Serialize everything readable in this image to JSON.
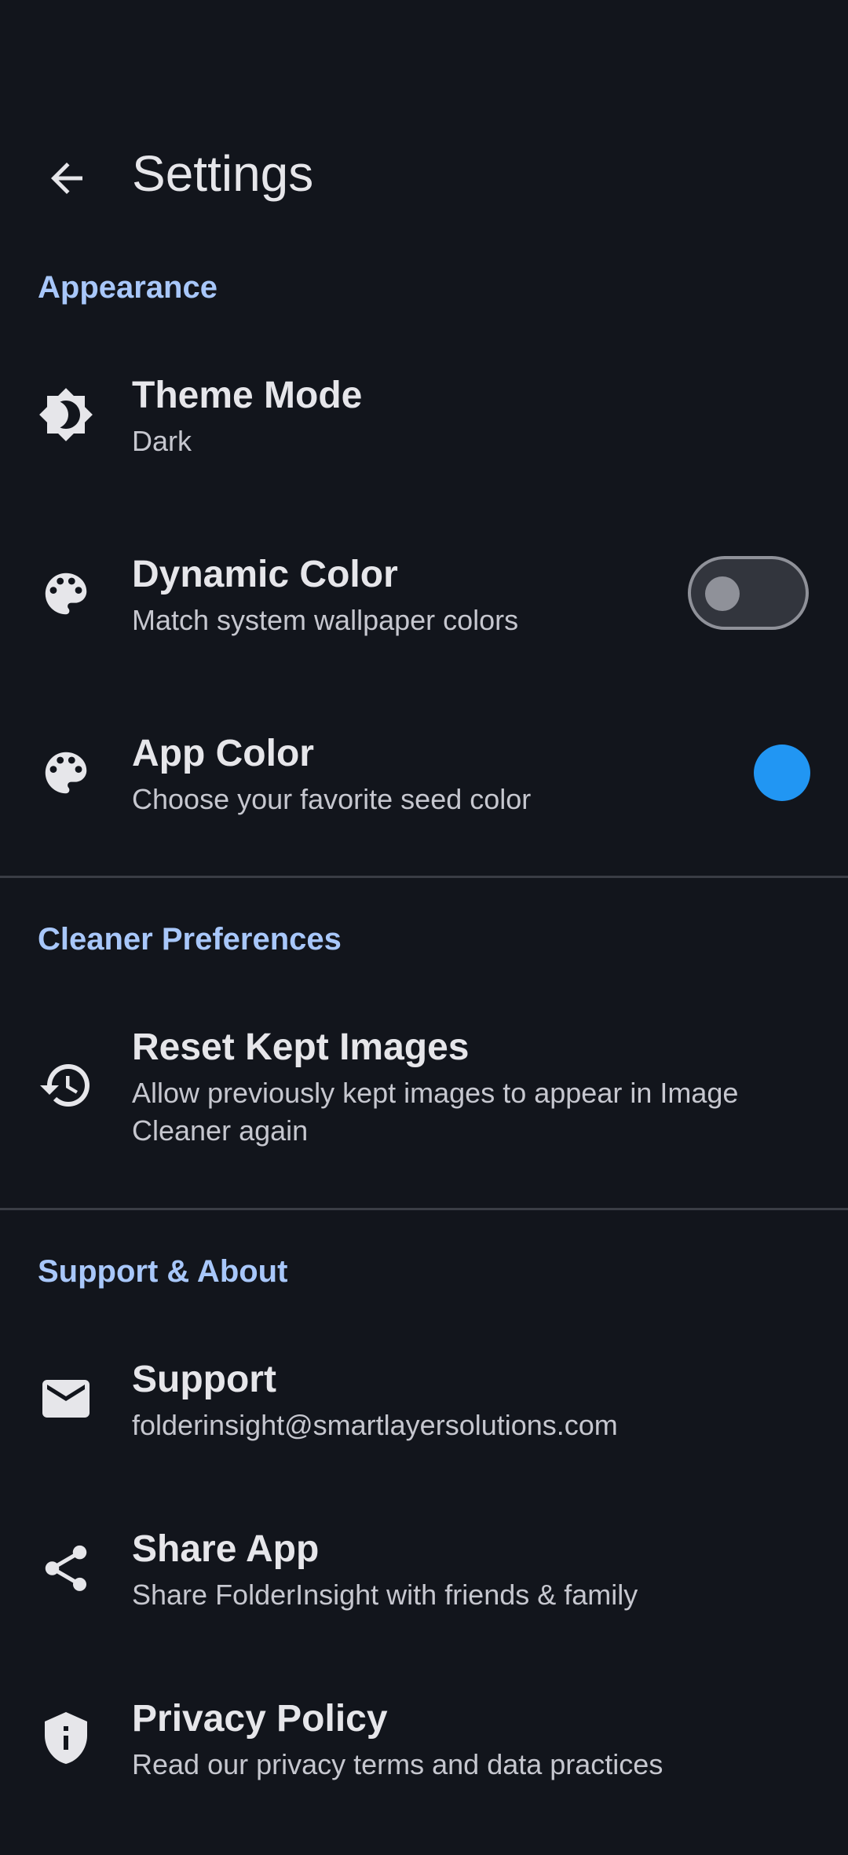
{
  "header": {
    "title": "Settings",
    "back_icon": "arrow-back-icon"
  },
  "appearance": {
    "header": "Appearance",
    "theme_mode": {
      "title": "Theme Mode",
      "value": "Dark",
      "icon": "brightness-icon"
    },
    "dynamic_color": {
      "title": "Dynamic Color",
      "subtitle": "Match system wallpaper colors",
      "icon": "palette-icon",
      "enabled": false
    },
    "app_color": {
      "title": "App Color",
      "subtitle": "Choose your favorite seed color",
      "icon": "palette-icon",
      "swatch_color": "#2196f3"
    }
  },
  "cleaner": {
    "header": "Cleaner Preferences",
    "reset_kept": {
      "title": "Reset Kept Images",
      "subtitle": "Allow previously kept images to appear in Image Cleaner again",
      "icon": "history-icon"
    }
  },
  "support_about": {
    "header": "Support & About",
    "support": {
      "title": "Support",
      "subtitle": "folderinsight@smartlayersolutions.com",
      "icon": "email-icon"
    },
    "share": {
      "title": "Share App",
      "subtitle": "Share FolderInsight with friends & family",
      "icon": "share-icon"
    },
    "privacy": {
      "title": "Privacy Policy",
      "subtitle": "Read our privacy terms and data practices",
      "icon": "privacy-shield-icon"
    }
  },
  "colors": {
    "background": "#12151c",
    "accent": "#a8c7fa",
    "text_primary": "#e6e6ea",
    "text_secondary": "#c6c7cf",
    "divider": "#3a3d45"
  }
}
